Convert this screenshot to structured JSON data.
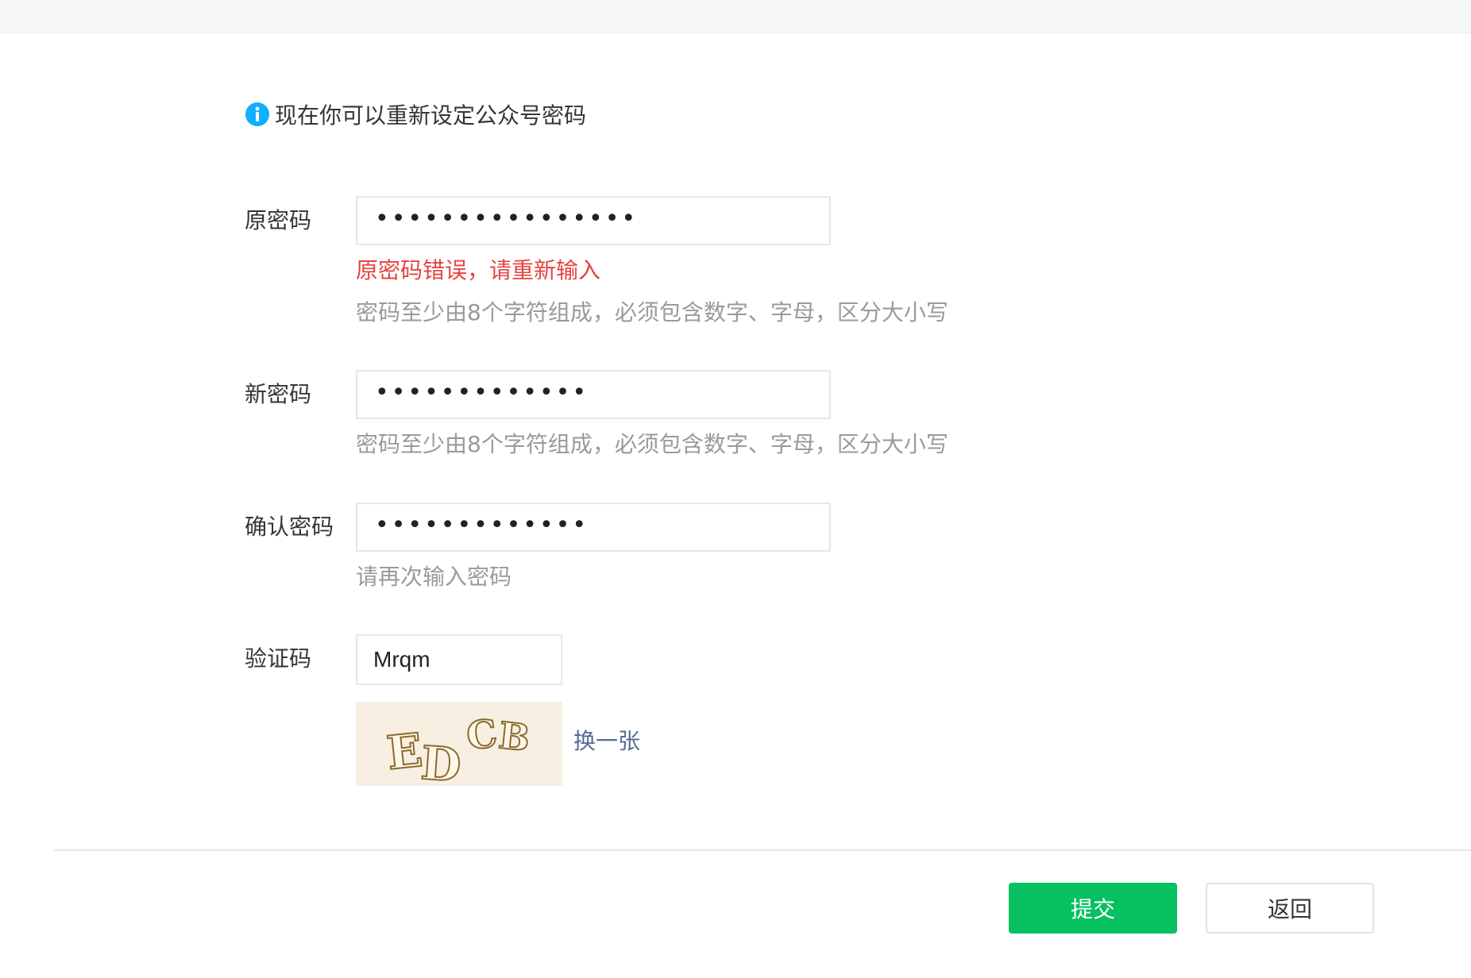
{
  "notice": {
    "icon": "info-icon",
    "text": "现在你可以重新设定公众号密码",
    "icon_color": "#10aeff"
  },
  "form": {
    "old_password": {
      "label": "原密码",
      "masked_value": "••••••••••••••••",
      "error": "原密码错误，请重新输入",
      "hint": "密码至少由8个字符组成，必须包含数字、字母，区分大小写"
    },
    "new_password": {
      "label": "新密码",
      "masked_value": "•••••••••••••",
      "hint": "密码至少由8个字符组成，必须包含数字、字母，区分大小写"
    },
    "confirm_password": {
      "label": "确认密码",
      "masked_value": "•••••••••••••",
      "hint": "请再次输入密码"
    },
    "captcha": {
      "label": "验证码",
      "value": "Mrqm",
      "image_text": "EDCB",
      "refresh_label": "换一张"
    }
  },
  "actions": {
    "submit_label": "提交",
    "back_label": "返回"
  },
  "colors": {
    "accent": "#07c160",
    "error": "#e64340",
    "link": "#576b95",
    "hint": "#9a9a9a"
  }
}
